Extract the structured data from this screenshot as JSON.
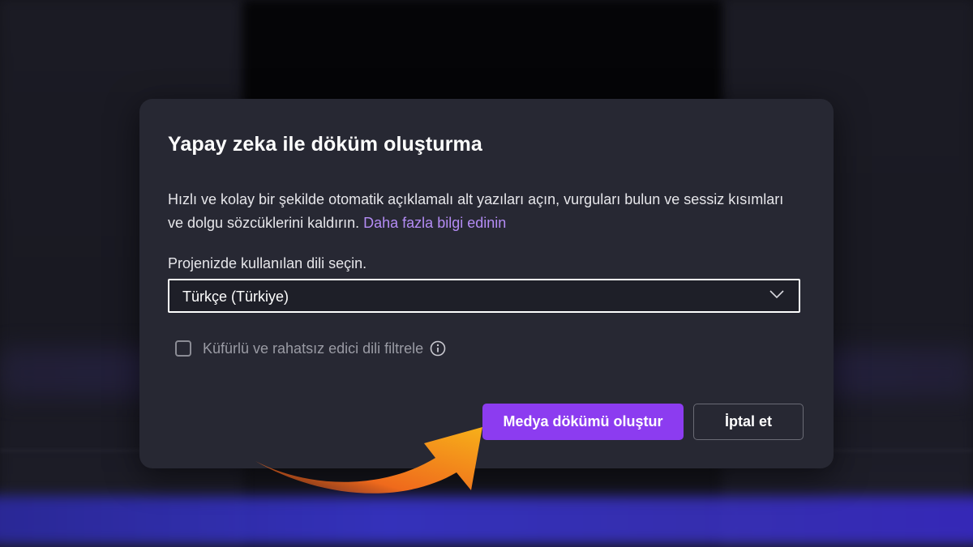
{
  "dialog": {
    "title": "Yapay zeka ile döküm oluşturma",
    "description": "Hızlı ve kolay bir şekilde otomatik açıklamalı alt yazıları açın, vurguları bulun ve sessiz kısımları ve dolgu sözcüklerini kaldırın.",
    "learn_more_link": "Daha fazla bilgi edinin",
    "language_label": "Projenizde kullanılan dili seçin.",
    "language_selected": "Türkçe (Türkiye)",
    "profanity_filter_label": "Küfürlü ve rahatsız edici dili filtrele",
    "profanity_filter_checked": false,
    "primary_button": "Medya dökümü oluştur",
    "cancel_button": "İptal et"
  },
  "icons": {
    "dropdown": "chevron-down-icon",
    "info": "info-icon",
    "annotation": "arrow-annotation-icon"
  },
  "colors": {
    "accent": "#8c3cf0",
    "link": "#b48cf5",
    "dialog_bg": "#272833",
    "arrow": "#f5a316"
  }
}
